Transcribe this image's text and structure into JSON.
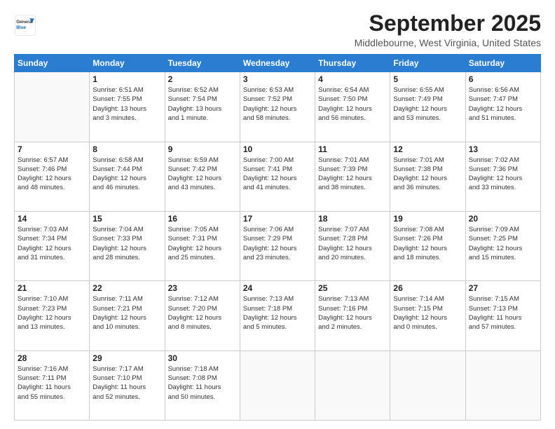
{
  "logo": {
    "general": "General",
    "blue": "Blue"
  },
  "header": {
    "month_title": "September 2025",
    "location": "Middlebourne, West Virginia, United States"
  },
  "weekdays": [
    "Sunday",
    "Monday",
    "Tuesday",
    "Wednesday",
    "Thursday",
    "Friday",
    "Saturday"
  ],
  "weeks": [
    [
      {
        "day": "",
        "info": ""
      },
      {
        "day": "1",
        "info": "Sunrise: 6:51 AM\nSunset: 7:55 PM\nDaylight: 13 hours\nand 3 minutes."
      },
      {
        "day": "2",
        "info": "Sunrise: 6:52 AM\nSunset: 7:54 PM\nDaylight: 13 hours\nand 1 minute."
      },
      {
        "day": "3",
        "info": "Sunrise: 6:53 AM\nSunset: 7:52 PM\nDaylight: 12 hours\nand 58 minutes."
      },
      {
        "day": "4",
        "info": "Sunrise: 6:54 AM\nSunset: 7:50 PM\nDaylight: 12 hours\nand 56 minutes."
      },
      {
        "day": "5",
        "info": "Sunrise: 6:55 AM\nSunset: 7:49 PM\nDaylight: 12 hours\nand 53 minutes."
      },
      {
        "day": "6",
        "info": "Sunrise: 6:56 AM\nSunset: 7:47 PM\nDaylight: 12 hours\nand 51 minutes."
      }
    ],
    [
      {
        "day": "7",
        "info": "Sunrise: 6:57 AM\nSunset: 7:46 PM\nDaylight: 12 hours\nand 48 minutes."
      },
      {
        "day": "8",
        "info": "Sunrise: 6:58 AM\nSunset: 7:44 PM\nDaylight: 12 hours\nand 46 minutes."
      },
      {
        "day": "9",
        "info": "Sunrise: 6:59 AM\nSunset: 7:42 PM\nDaylight: 12 hours\nand 43 minutes."
      },
      {
        "day": "10",
        "info": "Sunrise: 7:00 AM\nSunset: 7:41 PM\nDaylight: 12 hours\nand 41 minutes."
      },
      {
        "day": "11",
        "info": "Sunrise: 7:01 AM\nSunset: 7:39 PM\nDaylight: 12 hours\nand 38 minutes."
      },
      {
        "day": "12",
        "info": "Sunrise: 7:01 AM\nSunset: 7:38 PM\nDaylight: 12 hours\nand 36 minutes."
      },
      {
        "day": "13",
        "info": "Sunrise: 7:02 AM\nSunset: 7:36 PM\nDaylight: 12 hours\nand 33 minutes."
      }
    ],
    [
      {
        "day": "14",
        "info": "Sunrise: 7:03 AM\nSunset: 7:34 PM\nDaylight: 12 hours\nand 31 minutes."
      },
      {
        "day": "15",
        "info": "Sunrise: 7:04 AM\nSunset: 7:33 PM\nDaylight: 12 hours\nand 28 minutes."
      },
      {
        "day": "16",
        "info": "Sunrise: 7:05 AM\nSunset: 7:31 PM\nDaylight: 12 hours\nand 25 minutes."
      },
      {
        "day": "17",
        "info": "Sunrise: 7:06 AM\nSunset: 7:29 PM\nDaylight: 12 hours\nand 23 minutes."
      },
      {
        "day": "18",
        "info": "Sunrise: 7:07 AM\nSunset: 7:28 PM\nDaylight: 12 hours\nand 20 minutes."
      },
      {
        "day": "19",
        "info": "Sunrise: 7:08 AM\nSunset: 7:26 PM\nDaylight: 12 hours\nand 18 minutes."
      },
      {
        "day": "20",
        "info": "Sunrise: 7:09 AM\nSunset: 7:25 PM\nDaylight: 12 hours\nand 15 minutes."
      }
    ],
    [
      {
        "day": "21",
        "info": "Sunrise: 7:10 AM\nSunset: 7:23 PM\nDaylight: 12 hours\nand 13 minutes."
      },
      {
        "day": "22",
        "info": "Sunrise: 7:11 AM\nSunset: 7:21 PM\nDaylight: 12 hours\nand 10 minutes."
      },
      {
        "day": "23",
        "info": "Sunrise: 7:12 AM\nSunset: 7:20 PM\nDaylight: 12 hours\nand 8 minutes."
      },
      {
        "day": "24",
        "info": "Sunrise: 7:13 AM\nSunset: 7:18 PM\nDaylight: 12 hours\nand 5 minutes."
      },
      {
        "day": "25",
        "info": "Sunrise: 7:13 AM\nSunset: 7:16 PM\nDaylight: 12 hours\nand 2 minutes."
      },
      {
        "day": "26",
        "info": "Sunrise: 7:14 AM\nSunset: 7:15 PM\nDaylight: 12 hours\nand 0 minutes."
      },
      {
        "day": "27",
        "info": "Sunrise: 7:15 AM\nSunset: 7:13 PM\nDaylight: 11 hours\nand 57 minutes."
      }
    ],
    [
      {
        "day": "28",
        "info": "Sunrise: 7:16 AM\nSunset: 7:11 PM\nDaylight: 11 hours\nand 55 minutes."
      },
      {
        "day": "29",
        "info": "Sunrise: 7:17 AM\nSunset: 7:10 PM\nDaylight: 11 hours\nand 52 minutes."
      },
      {
        "day": "30",
        "info": "Sunrise: 7:18 AM\nSunset: 7:08 PM\nDaylight: 11 hours\nand 50 minutes."
      },
      {
        "day": "",
        "info": ""
      },
      {
        "day": "",
        "info": ""
      },
      {
        "day": "",
        "info": ""
      },
      {
        "day": "",
        "info": ""
      }
    ]
  ]
}
